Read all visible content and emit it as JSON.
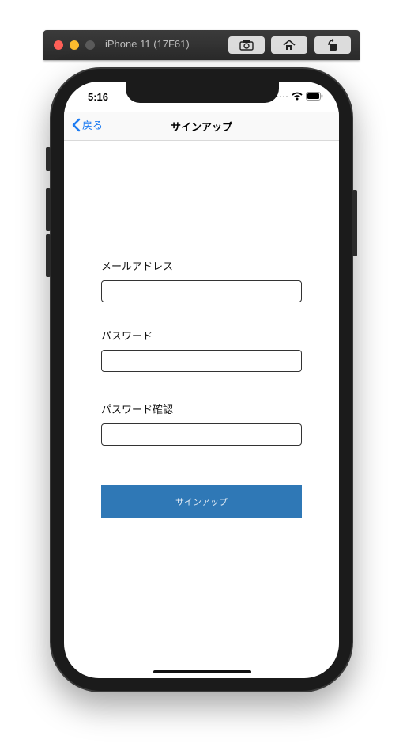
{
  "simulator": {
    "title": "iPhone 11 (17F61)",
    "buttons": [
      "screenshot-icon",
      "home-icon",
      "rotate-icon"
    ]
  },
  "status_bar": {
    "time": "5:16"
  },
  "nav": {
    "back_label": "戻る",
    "title": "サインアップ"
  },
  "form": {
    "email_label": "メールアドレス",
    "email_value": "",
    "password_label": "パスワード",
    "password_value": "",
    "password_confirm_label": "パスワード確認",
    "password_confirm_value": "",
    "submit_label": "サインアップ"
  },
  "colors": {
    "accent": "#1d7cf2",
    "button_bg": "#2f78b6",
    "button_text": "#dfe9f3"
  }
}
